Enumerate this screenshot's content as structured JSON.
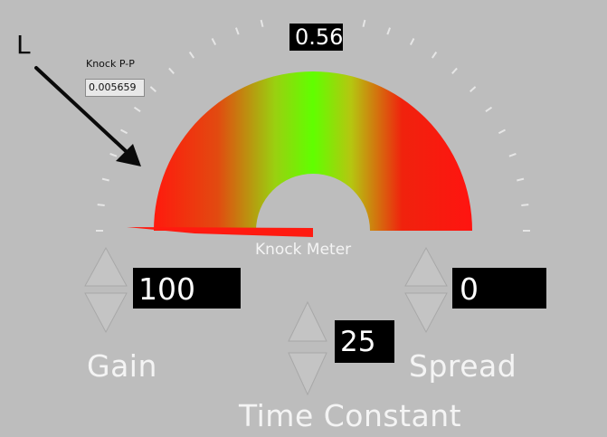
{
  "annotation": {
    "letter": "L"
  },
  "gauge": {
    "title": "Knock Meter",
    "needle_display": "0.56",
    "level": 0.02
  },
  "knock_pp": {
    "label": "Knock P-P",
    "value": "0.005659"
  },
  "controls": {
    "gain": {
      "label": "Gain",
      "value": "100"
    },
    "spread": {
      "label": "Spread",
      "value": "0"
    },
    "time_constant": {
      "label": "Time Constant",
      "value": "25"
    }
  },
  "colors": {
    "background": "#bdbdbd",
    "gauge_low": "#ff1a1a",
    "gauge_high": "#66ff00"
  }
}
